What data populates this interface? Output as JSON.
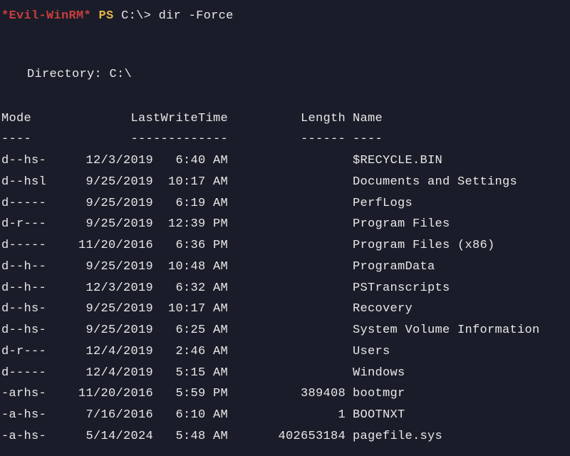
{
  "prompt": {
    "tool": "*Evil-WinRM*",
    "shell": "PS",
    "path_and_cmd": "C:\\> dir -Force"
  },
  "directory_label": "Directory: C:\\",
  "headers": {
    "mode": "Mode",
    "lastwrite": "LastWriteTime",
    "length": "Length",
    "name": "Name"
  },
  "separators": {
    "mode": "----",
    "lastwrite": "-------------",
    "length": "------",
    "name": "----"
  },
  "rows": [
    {
      "mode": "d--hs-",
      "date": "12/3/2019",
      "time": "6:40 AM",
      "length": "",
      "name": "$RECYCLE.BIN"
    },
    {
      "mode": "d--hsl",
      "date": "9/25/2019",
      "time": "10:17 AM",
      "length": "",
      "name": "Documents and Settings"
    },
    {
      "mode": "d-----",
      "date": "9/25/2019",
      "time": "6:19 AM",
      "length": "",
      "name": "PerfLogs"
    },
    {
      "mode": "d-r---",
      "date": "9/25/2019",
      "time": "12:39 PM",
      "length": "",
      "name": "Program Files"
    },
    {
      "mode": "d-----",
      "date": "11/20/2016",
      "time": "6:36 PM",
      "length": "",
      "name": "Program Files (x86)"
    },
    {
      "mode": "d--h--",
      "date": "9/25/2019",
      "time": "10:48 AM",
      "length": "",
      "name": "ProgramData"
    },
    {
      "mode": "d--h--",
      "date": "12/3/2019",
      "time": "6:32 AM",
      "length": "",
      "name": "PSTranscripts"
    },
    {
      "mode": "d--hs-",
      "date": "9/25/2019",
      "time": "10:17 AM",
      "length": "",
      "name": "Recovery"
    },
    {
      "mode": "d--hs-",
      "date": "9/25/2019",
      "time": "6:25 AM",
      "length": "",
      "name": "System Volume Information"
    },
    {
      "mode": "d-r---",
      "date": "12/4/2019",
      "time": "2:46 AM",
      "length": "",
      "name": "Users"
    },
    {
      "mode": "d-----",
      "date": "12/4/2019",
      "time": "5:15 AM",
      "length": "",
      "name": "Windows"
    },
    {
      "mode": "-arhs-",
      "date": "11/20/2016",
      "time": "5:59 PM",
      "length": "389408",
      "name": "bootmgr"
    },
    {
      "mode": "-a-hs-",
      "date": "7/16/2016",
      "time": "6:10 AM",
      "length": "1",
      "name": "BOOTNXT"
    },
    {
      "mode": "-a-hs-",
      "date": "5/14/2024",
      "time": "5:48 AM",
      "length": "402653184",
      "name": "pagefile.sys"
    }
  ]
}
